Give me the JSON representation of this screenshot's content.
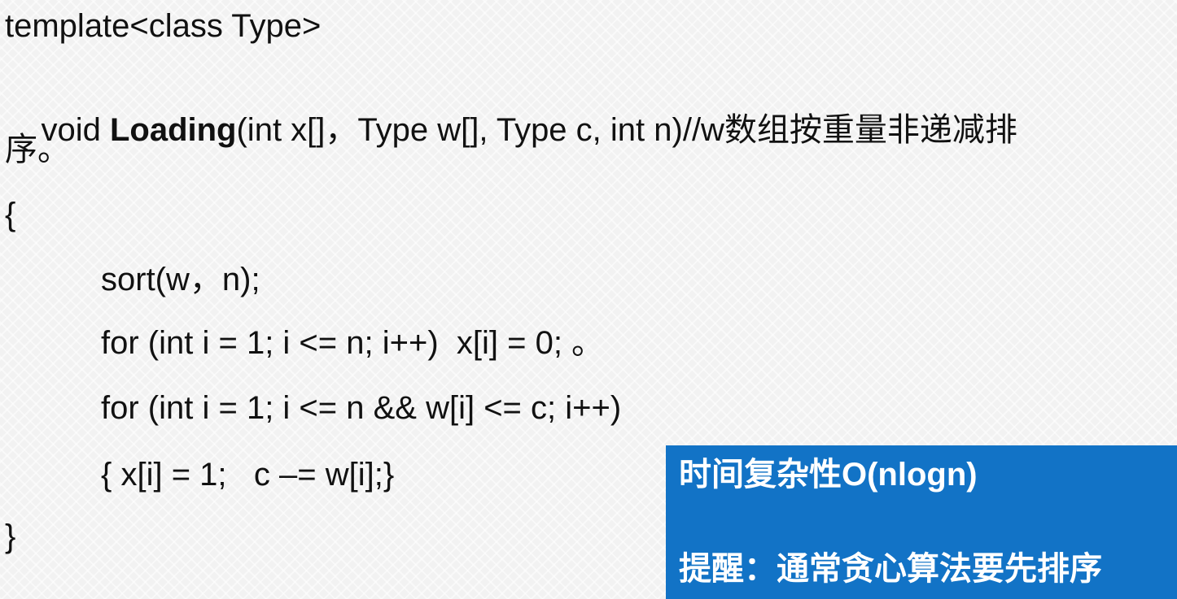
{
  "code": {
    "line_template": "template<class Type>",
    "line_sig_prefix": "void ",
    "line_sig_name": "Loading",
    "line_sig_rest": "(int x[]，Type w[], Type c, int n)//w数组按重量非递减排",
    "line_sig_wrap": "序。",
    "open_brace": "{",
    "line_sort": "sort(w，n);",
    "line_for1": "for (int i = 1; i <= n; i++)  x[i] = 0; 。",
    "line_for2": "for (int i = 1; i <= n && w[i] <= c; i++)",
    "line_body": "{ x[i] = 1;   c –= w[i];}",
    "close_brace": "}"
  },
  "note": {
    "complexity": "时间复杂性O(nlogn)",
    "reminder": "提醒：通常贪心算法要先排序"
  },
  "colors": {
    "note_background": "#1273c6",
    "note_text": "#ffffff",
    "code_text": "#111111",
    "page_background": "#f2f2f2"
  }
}
